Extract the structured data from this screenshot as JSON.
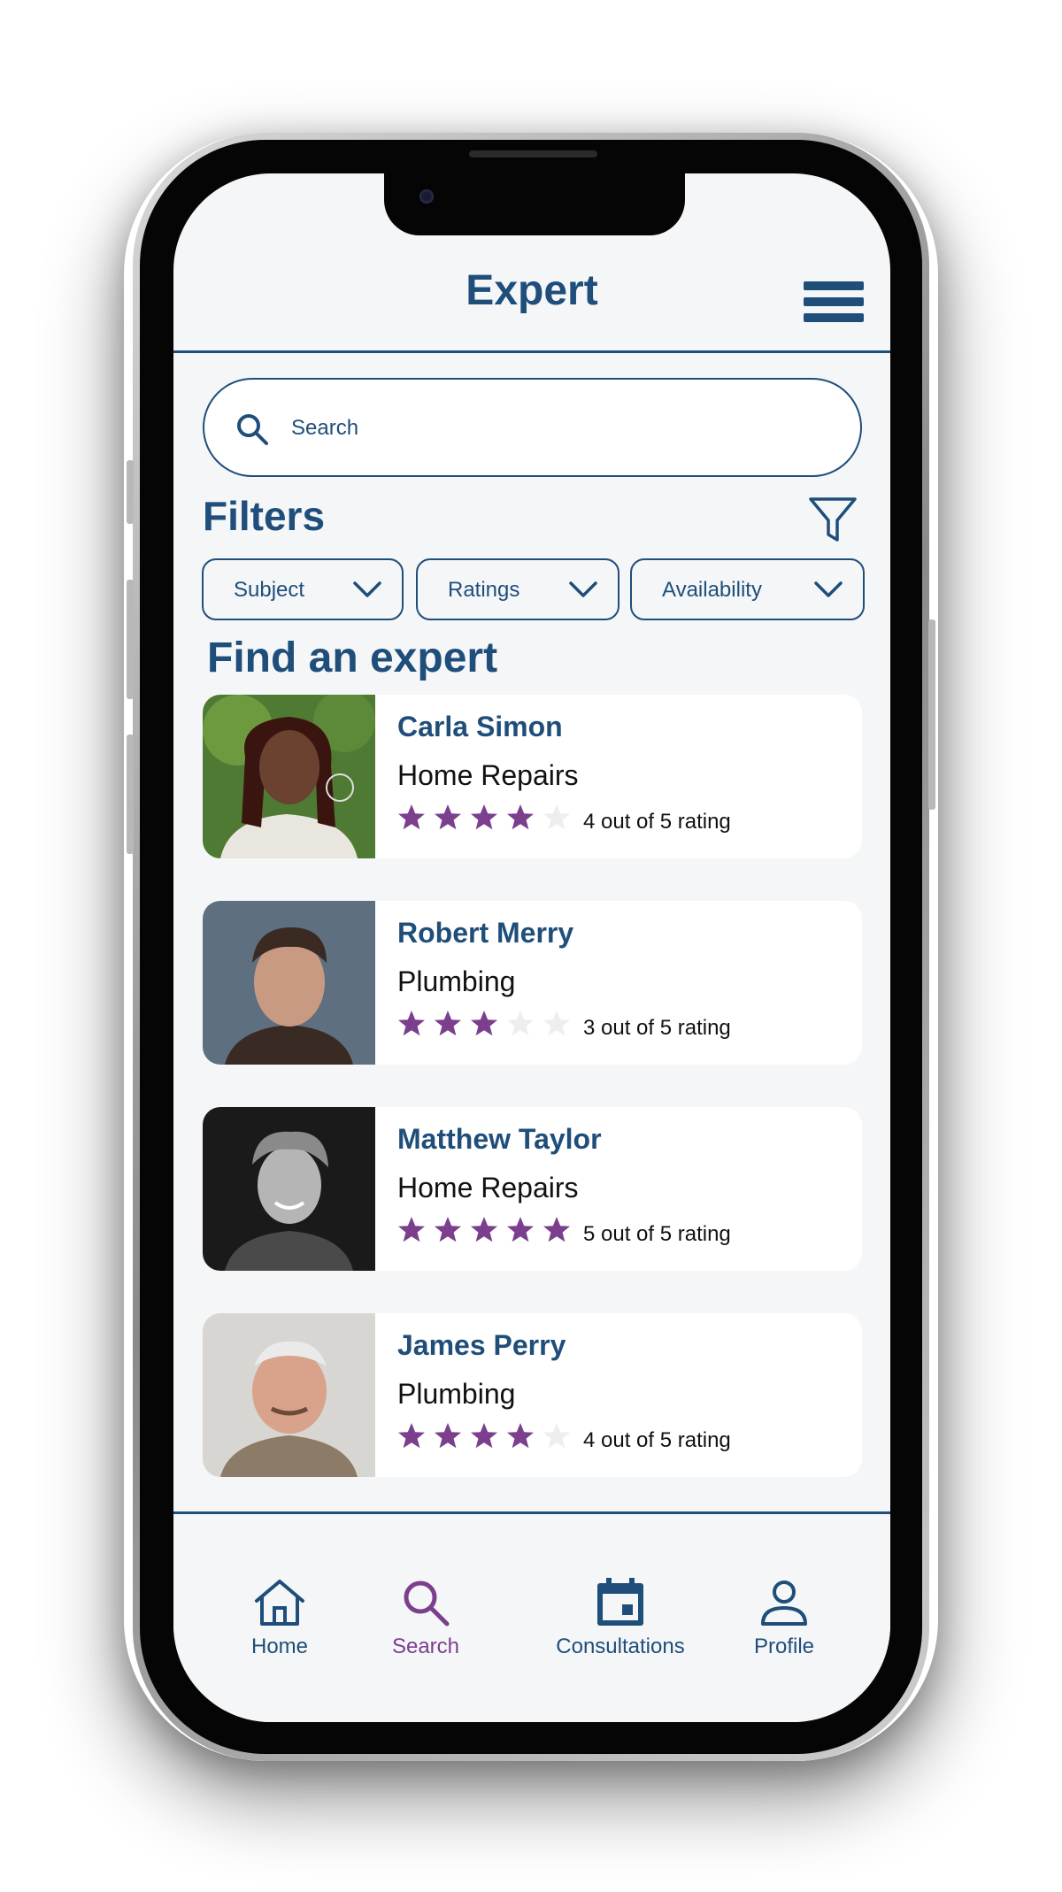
{
  "app": {
    "title": "Expert"
  },
  "search": {
    "placeholder": "Search"
  },
  "filters": {
    "title": "Filters",
    "chips": [
      "Subject",
      "Ratings",
      "Availability"
    ]
  },
  "section": {
    "title": "Find an expert"
  },
  "experts": [
    {
      "name": "Carla Simon",
      "category": "Home Repairs",
      "rating": 4,
      "rating_text": "4 out of 5 rating"
    },
    {
      "name": "Robert Merry",
      "category": "Plumbing",
      "rating": 3,
      "rating_text": "3 out of 5 rating"
    },
    {
      "name": "Matthew Taylor",
      "category": "Home Repairs",
      "rating": 5,
      "rating_text": "5 out of 5 rating"
    },
    {
      "name": "James Perry",
      "category": "Plumbing",
      "rating": 4,
      "rating_text": "4 out of 5 rating"
    }
  ],
  "nav": {
    "items": [
      {
        "label": "Home",
        "icon": "home-icon",
        "active": false
      },
      {
        "label": "Search",
        "icon": "search-icon",
        "active": true
      },
      {
        "label": "Consultations",
        "icon": "calendar-icon",
        "active": false
      },
      {
        "label": "Profile",
        "icon": "person-icon",
        "active": false
      }
    ]
  },
  "colors": {
    "primary": "#1f4e7a",
    "accent": "#7b3f8e",
    "star_off": "#eeeeee",
    "background": "#f5f6f8"
  }
}
